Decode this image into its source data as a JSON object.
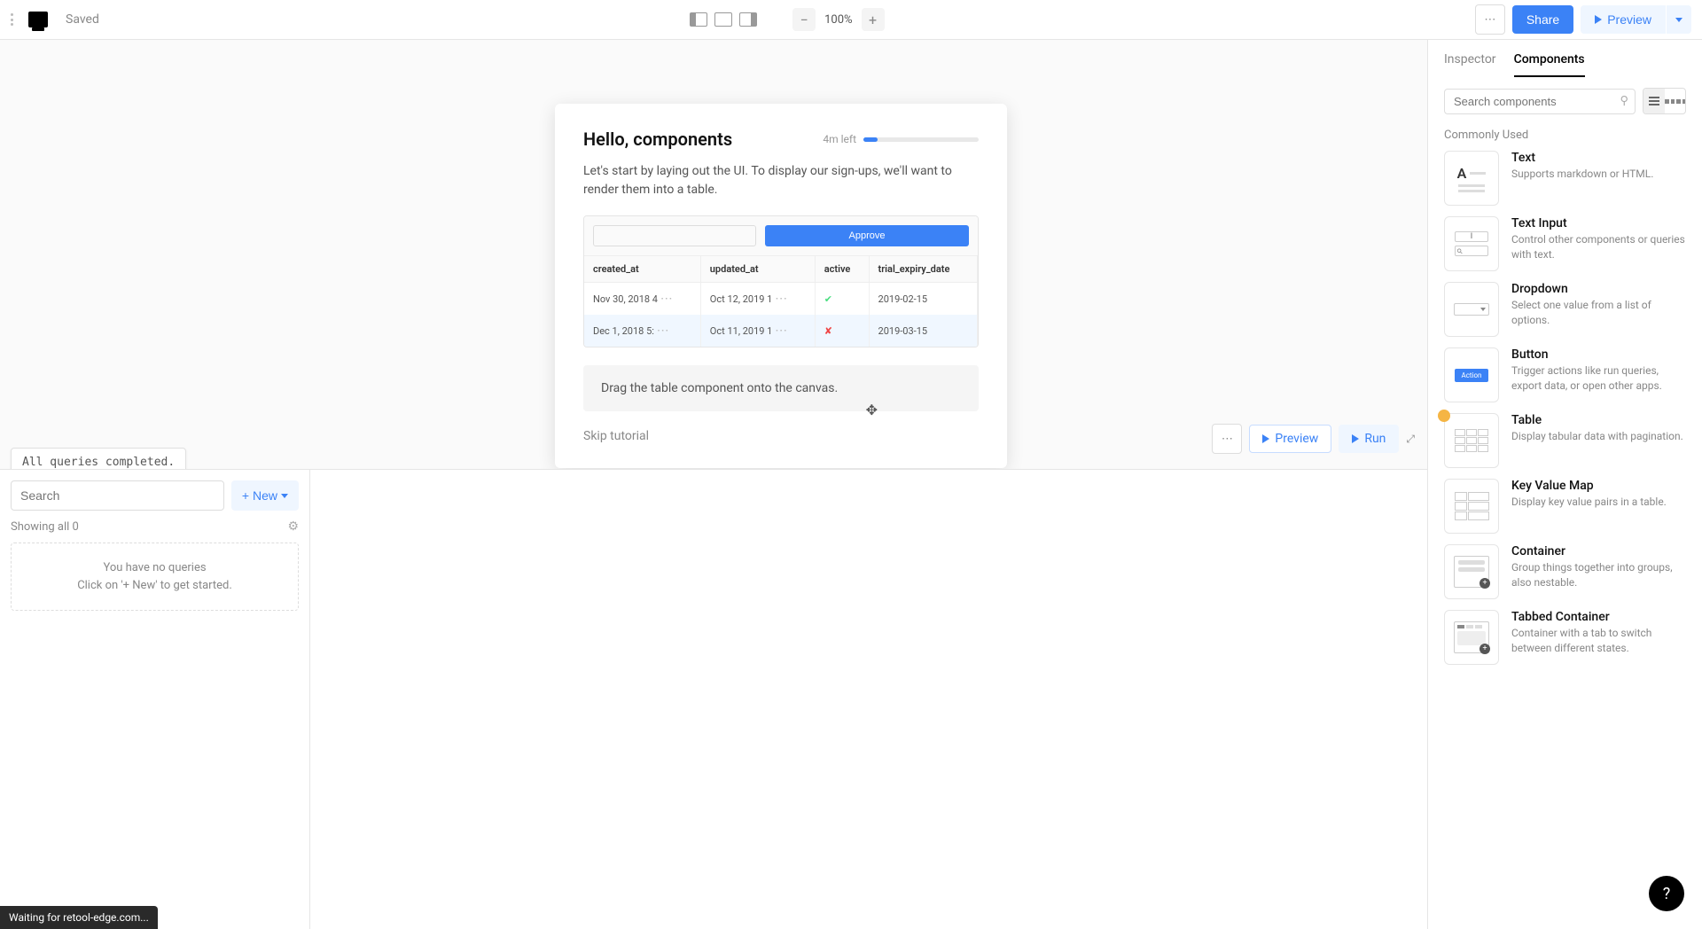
{
  "topbar": {
    "saved_label": "Saved",
    "zoom_level": "100%",
    "share_label": "Share",
    "preview_label": "Preview"
  },
  "right_panel": {
    "tabs": {
      "inspector": "Inspector",
      "components": "Components"
    },
    "search_placeholder": "Search components",
    "commonly_used_label": "Commonly Used",
    "components": [
      {
        "title": "Text",
        "desc": "Supports markdown or HTML."
      },
      {
        "title": "Text Input",
        "desc": "Control other components or queries with text."
      },
      {
        "title": "Dropdown",
        "desc": "Select one value from a list of options."
      },
      {
        "title": "Button",
        "desc": "Trigger actions like run queries, export data, or open other apps."
      },
      {
        "title": "Table",
        "desc": "Display tabular data with pagination."
      },
      {
        "title": "Key Value Map",
        "desc": "Display key value pairs in a table."
      },
      {
        "title": "Container",
        "desc": "Group things together into groups, also nestable."
      },
      {
        "title": "Tabbed Container",
        "desc": "Container with a tab to switch between different states."
      }
    ],
    "button_badge": "Action"
  },
  "tutorial": {
    "title": "Hello, components",
    "time_left": "4m left",
    "description": "Let's start by laying out the UI. To display our sign-ups, we'll want to render them into a table.",
    "demo": {
      "approve_label": "Approve",
      "headers": [
        "created_at",
        "updated_at",
        "active",
        "trial_expiry_date"
      ],
      "rows": [
        {
          "created": "Nov 30, 2018 4",
          "updated": "Oct 12, 2019 1",
          "active": true,
          "trial": "2019-02-15"
        },
        {
          "created": "Dec 1, 2018 5:",
          "updated": "Oct 11, 2019 1",
          "active": false,
          "trial": "2019-03-15"
        }
      ]
    },
    "instruction": "Drag the table component onto the canvas.",
    "skip_label": "Skip tutorial"
  },
  "bottom_panel": {
    "search_placeholder": "Search",
    "new_label": "+ New",
    "showing_label": "Showing all 0",
    "empty_line1": "You have no queries",
    "empty_line2": "Click on '+ New' to get started.",
    "preview_label": "Preview",
    "run_label": "Run"
  },
  "toast": "All queries completed.",
  "status_bar": "Waiting for retool-edge.com..."
}
